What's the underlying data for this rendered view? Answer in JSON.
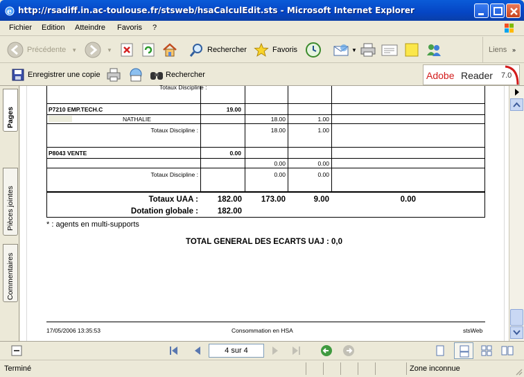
{
  "window": {
    "title": "http://rsadiff.in.ac-toulouse.fr/stsweb/hsaCalculEdit.sts - Microsoft Internet Explorer"
  },
  "menu": [
    "Fichier",
    "Edition",
    "Atteindre",
    "Favoris",
    "?"
  ],
  "toolbar": {
    "back": "Précédente",
    "search": "Rechercher",
    "favorites": "Favoris",
    "links": "Liens"
  },
  "reader_toolbar": {
    "save_copy": "Enregistrer une copie",
    "search": "Rechercher",
    "brand_adobe": "Adobe",
    "brand_reader": "Reader",
    "brand_version": "7.0"
  },
  "side_tabs": [
    "Pages",
    "Pièces jointes",
    "Commentaires"
  ],
  "document": {
    "top_partial_label": "Totaux Discipline :",
    "rows": {
      "p7210_title": "P7210 EMP.TECH.C",
      "p7210_value": "19.00",
      "nathalie_name": "NATHALIE",
      "nathalie_v1": "18.00",
      "nathalie_v2": "1.00",
      "p7210_tot_label": "Totaux Discipline :",
      "p7210_tot_v1": "18.00",
      "p7210_tot_v2": "1.00",
      "p8043_title": "P8043 VENTE",
      "p8043_value": "0.00",
      "p8043_v1": "0.00",
      "p8043_v2": "0.00",
      "p8043_tot_label": "Totaux Discipline :",
      "p8043_tot_v1": "0.00",
      "p8043_tot_v2": "0.00"
    },
    "totals": {
      "uaa_label": "Totaux UAA :",
      "uaa_v1": "182.00",
      "uaa_v2": "173.00",
      "uaa_v3": "9.00",
      "uaa_v4": "0.00",
      "dotation_label": "Dotation globale :",
      "dotation_v": "182.00"
    },
    "note": "* : agents en multi-supports",
    "grand_total": "TOTAL GENERAL DES ECARTS UAJ : 0,0",
    "footer": {
      "date": "17/05/2006 13:35:53",
      "center": "Consommation en HSA",
      "right": "stsWeb"
    }
  },
  "nav": {
    "page_indicator": "4 sur 4"
  },
  "status": {
    "left": "Terminé",
    "zone": "Zone inconnue"
  },
  "colors": {
    "titlebar": "#0a5bd8",
    "chrome": "#ece9d8",
    "adobe_red": "#d21b1b"
  }
}
